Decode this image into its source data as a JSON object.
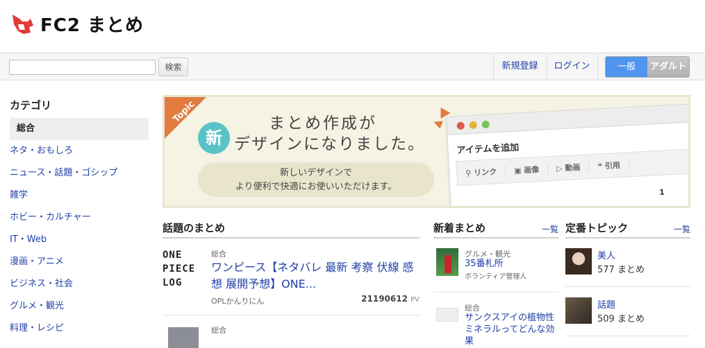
{
  "header": {
    "logo_text": "FC2 まとめ"
  },
  "toolbar": {
    "search_value": "",
    "search_button": "検索",
    "register": "新規登録",
    "login": "ログイン",
    "mode_general": "一般",
    "mode_adult": "アダルト"
  },
  "sidebar": {
    "title": "カテゴリ",
    "items": [
      {
        "label": "総合"
      },
      {
        "label": "ネタ・おもしろ"
      },
      {
        "label": "ニュース・話題・ゴシップ"
      },
      {
        "label": "雑学"
      },
      {
        "label": "ホビー・カルチャー"
      },
      {
        "label": "IT・Web"
      },
      {
        "label": "漫画・アニメ"
      },
      {
        "label": "ビジネス・社会"
      },
      {
        "label": "グルメ・観光"
      },
      {
        "label": "料理・レシピ"
      }
    ]
  },
  "banner": {
    "topic_label": "Topic",
    "line1": "まとめ作成が",
    "badge": "新",
    "line2": "デザインになりました。",
    "sub_line1": "新しいデザインで",
    "sub_line2": "より便利で快適にお使いいただけます。",
    "mock_title": "アイテムを追加",
    "mock_tools": [
      "リンク",
      "画像",
      "動画",
      "引用"
    ],
    "mock_page": "1"
  },
  "trending": {
    "title": "話題のまとめ",
    "items": [
      {
        "thumb_lines": [
          "ONE",
          "PIECE",
          "LOG"
        ],
        "category": "総合",
        "title": "ワンピース【ネタバレ 最新 考察 伏線 感想 展開予想】ONE...",
        "author": "OPLかんりにん",
        "pv": "21190612",
        "pv_unit": "PV"
      },
      {
        "category": "総合"
      }
    ]
  },
  "new_matome": {
    "title": "新着まとめ",
    "more": "一覧",
    "items": [
      {
        "category": "グルメ・観光",
        "title": "35番札所",
        "owner": "ボランティア管理人"
      },
      {
        "category": "総合",
        "title": "サンクスアイの植物性ミネラルってどんな効果"
      }
    ]
  },
  "topics": {
    "title": "定番トピック",
    "more": "一覧",
    "items": [
      {
        "name": "美人",
        "count": "577 まとめ"
      },
      {
        "name": "話題",
        "count": "509 まとめ"
      }
    ]
  },
  "colors": {
    "link": "#1f3fa8",
    "accent_blue": "#4f95ef",
    "logo_red": "#e23b3b",
    "topic_orange": "#e17b3f",
    "badge_teal": "#5ac3c8"
  }
}
